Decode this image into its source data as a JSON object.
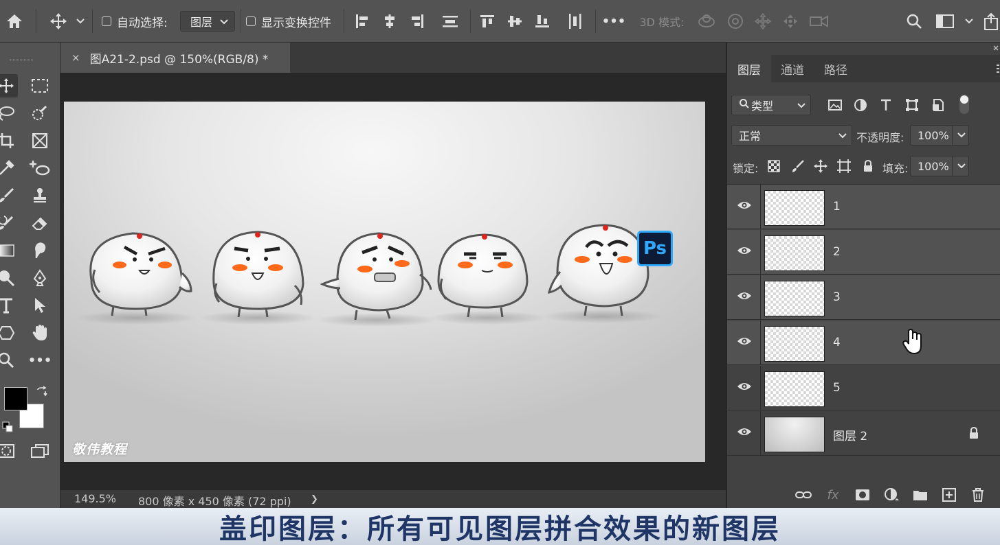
{
  "options_bar": {
    "auto_select_label": "自动选择:",
    "auto_select_value": "图层",
    "show_transform_label": "显示变换控件",
    "more_label": "•••",
    "mode_3d_label": "3D 模式:"
  },
  "toolbar": {
    "more_label": "•••",
    "foreground_color": "#000000",
    "background_color": "#ffffff"
  },
  "document": {
    "tab_title": "图A21-2.psd @ 150%(RGB/8) *",
    "close_label": "×",
    "watermark": "敬伟教程",
    "ps_badge": "Ps",
    "zoom": "149.5%",
    "doc_info": "800 像素 x 450 像素 (72 ppi)",
    "status_arrow": "❯"
  },
  "layers_panel": {
    "tabs": [
      {
        "label": "图层"
      },
      {
        "label": "通道"
      },
      {
        "label": "路径"
      }
    ],
    "filter_kind": "类型",
    "blend_mode": "正常",
    "opacity_label": "不透明度:",
    "opacity_value": "100%",
    "lock_label": "锁定:",
    "fill_label": "填充:",
    "fill_value": "100%",
    "layers": [
      {
        "name": "1",
        "selected": true
      },
      {
        "name": "2",
        "selected": true
      },
      {
        "name": "3",
        "selected": true
      },
      {
        "name": "4",
        "selected": true
      },
      {
        "name": "5",
        "selected": false
      },
      {
        "name": "图层 2",
        "selected": false,
        "locked": true
      }
    ],
    "footer_fx": "fx"
  },
  "subtitle": "盖印图层：所有可见图层拼合效果的新图层",
  "colors": {
    "accent_blue": "#1e3566",
    "ps_badge_bg": "#0d1b36",
    "ps_badge_border": "#31a8ff"
  }
}
